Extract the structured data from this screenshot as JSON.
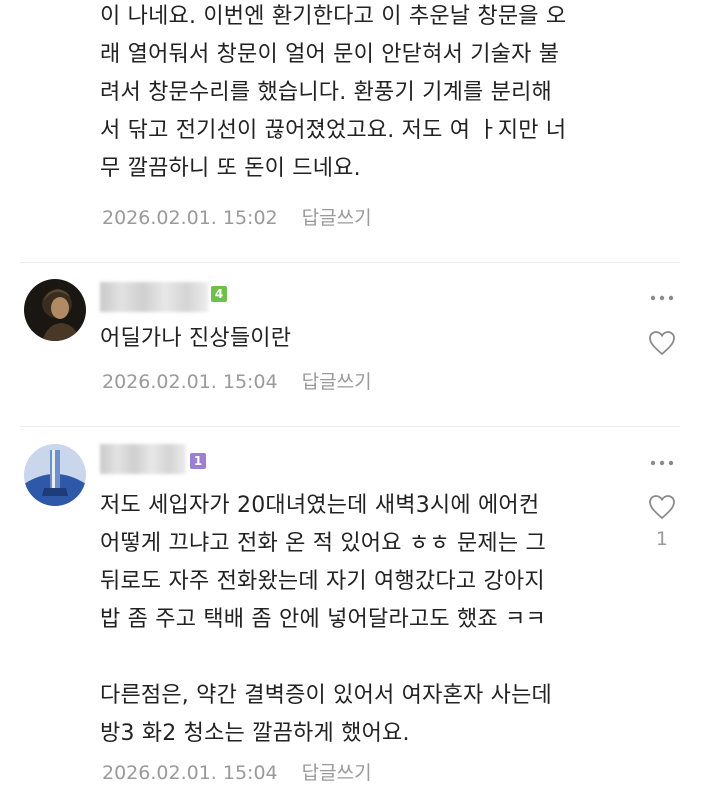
{
  "comment_prev": {
    "body": "이 나네요. 이번엔 환기한다고 이 추운날 창문을 오\n래 열어둬서 창문이 얼어 문이 안닫혀서 기술자 불\n려서 창문수리를 했습니다. 환풍기 기계를 분리해\n서 닦고 전기선이 끊어졌었고요. 저도 여 ㅏ지만 너\n무 깔끔하니 또 돈이 드네요.",
    "date": "2026.02.01. 15:02",
    "reply_label": "답글쓰기"
  },
  "comment_2": {
    "level": "4",
    "level_color": "#6fbf4a",
    "avatar_icon": "profile-photo-dark",
    "body": "어딜가나 진상들이란",
    "date": "2026.02.01. 15:04",
    "reply_label": "답글쓰기",
    "more_icon": "more-dots-icon",
    "like_icon": "heart-outline-icon"
  },
  "comment_3": {
    "level": "1",
    "level_color": "#9b7fd4",
    "avatar_icon": "profile-photo-blue",
    "body": "저도 세입자가 20대녀였는데 새벽3시에 에어컨\n어떻게 끄냐고 전화 온 적 있어요 ㅎㅎ 문제는 그\n뒤로도 자주 전화왔는데 자기 여행갔다고 강아지\n밥 좀 주고 택배 좀 안에 넣어달라고도 했죠 ㅋㅋ\n\n다른점은, 약간 결벽증이 있어서 여자혼자 사는데\n방3 화2 청소는 깔끔하게 했어요.",
    "date": "2026.02.01. 15:04",
    "reply_label": "답글쓰기",
    "like_count": "1",
    "more_icon": "more-dots-icon",
    "like_icon": "heart-outline-icon"
  },
  "colors": {
    "meta_text": "#9a9a9a",
    "divider": "#ededed",
    "body_text": "#222222"
  }
}
